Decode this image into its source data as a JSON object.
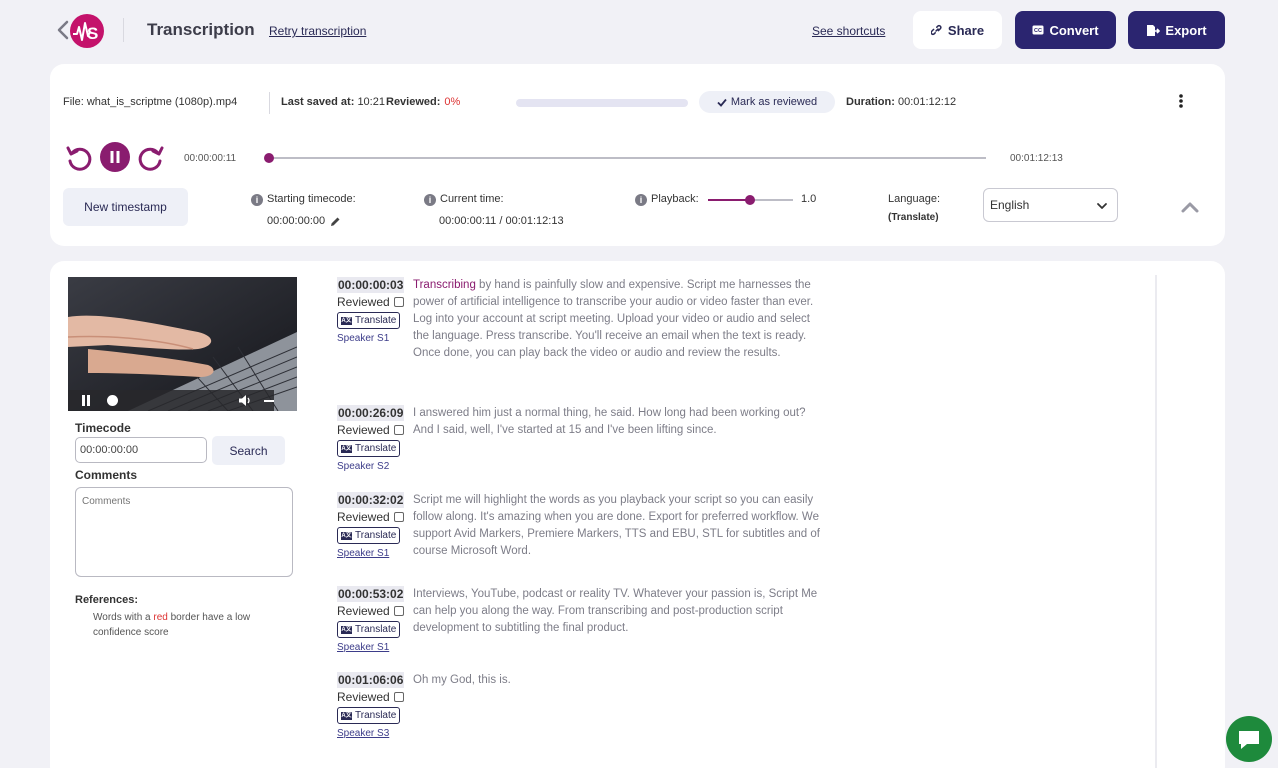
{
  "header": {
    "title": "Transcription",
    "retry_label": "Retry transcription",
    "shortcuts_label": "See shortcuts",
    "share_label": "Share",
    "convert_label": "Convert",
    "export_label": "Export"
  },
  "file_bar": {
    "file_label": "File:",
    "file_name": "what_is_scriptme (1080p).mp4",
    "saved_label": "Last saved at:",
    "saved_value": "10:21",
    "reviewed_label": "Reviewed:",
    "reviewed_value": "0%",
    "reviewed_fraction": 0,
    "mark_reviewed_label": "Mark as reviewed",
    "duration_label": "Duration:",
    "duration_value": "00:01:12:12"
  },
  "player": {
    "elapsed": "00:00:00:11",
    "total": "00:01:12:13",
    "progress_fraction": 0.003
  },
  "controls": {
    "new_timestamp_label": "New timestamp",
    "starting_timecode_label": "Starting timecode:",
    "starting_timecode_value": "00:00:00:00",
    "current_time_label": "Current time:",
    "current_time_value": "00:00:00:11 / 00:01:12:13",
    "playback_label": "Playback:",
    "playback_value": "1.0",
    "playback_fraction": 0.5,
    "language_label": "Language:",
    "language_sub": "(Translate)",
    "language_value": "English"
  },
  "sidebar": {
    "timecode_label": "Timecode",
    "timecode_value": "00:00:00:00",
    "search_label": "Search",
    "comments_label": "Comments",
    "comments_placeholder": "Comments",
    "references_label": "References:",
    "ref_prefix": "Words with a ",
    "ref_red": "red",
    "ref_suffix": " border have a low confidence score"
  },
  "segments": [
    {
      "time": "00:00:00:03",
      "reviewed_label": "Reviewed",
      "translate_label": "Translate",
      "speaker": "Speaker S1",
      "highlight": "Transcribing",
      "text": " by hand is painfully slow and expensive. Script me harnesses the power of artificial intelligence to transcribe your audio or video faster than ever. Log into your account at script meeting. Upload your video or audio and select the language. Press transcribe. You'll receive an email when the text is ready. Once done, you can play back the video or audio and review the results."
    },
    {
      "time": "00:00:26:09",
      "reviewed_label": "Reviewed",
      "translate_label": "Translate",
      "speaker": "Speaker S2",
      "highlight": "",
      "text": "I answered him just a normal thing, he said. How long had been working out? And I said, well, I've started at 15 and I've been lifting since."
    },
    {
      "time": "00:00:32:02",
      "reviewed_label": "Reviewed",
      "translate_label": "Translate",
      "speaker": "Speaker S1",
      "highlight": "",
      "text": "Script me will highlight the words as you playback your script so you can easily follow along. It's amazing when you are done. Export for preferred workflow. We support Avid Markers, Premiere Markers, TTS and EBU, STL for subtitles and of course Microsoft Word."
    },
    {
      "time": "00:00:53:02",
      "reviewed_label": "Reviewed",
      "translate_label": "Translate",
      "speaker": "Speaker S1",
      "highlight": "",
      "text": "Interviews, YouTube, podcast or reality TV. Whatever your passion is, Script Me can help you along the way. From transcribing and post-production script development to subtitling the final product."
    },
    {
      "time": "00:01:06:06",
      "reviewed_label": "Reviewed",
      "translate_label": "Translate",
      "speaker": "Speaker S3",
      "highlight": "",
      "text": "Oh my God, this is."
    }
  ],
  "colors": {
    "accent": "#8a1c6f",
    "primary_dark": "#2b2570",
    "logo": "#c4126b",
    "low_confidence": "#dd3333",
    "chat": "#1e8a3c"
  },
  "icons": [
    "back-chevron-icon",
    "logo-icon",
    "link-icon",
    "cc-icon",
    "export-file-icon",
    "check-icon",
    "kebab-icon",
    "undo-icon",
    "pause-icon",
    "redo-icon",
    "info-icon",
    "pencil-icon",
    "chevron-down-icon",
    "chevron-up-icon",
    "volume-icon",
    "translate-icon",
    "chat-icon"
  ]
}
